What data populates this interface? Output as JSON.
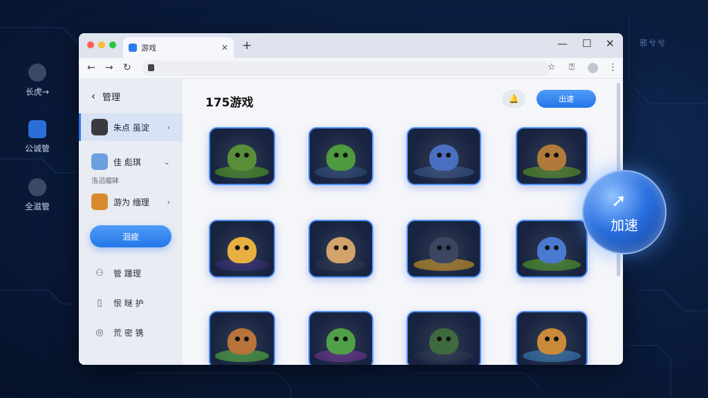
{
  "desktop": {
    "items": [
      {
        "label": "长虎→",
        "icon": "leaf-icon"
      },
      {
        "label": "公诚管",
        "icon": "chart-search-icon"
      },
      {
        "label": "全滋管",
        "icon": "gear-icon"
      }
    ],
    "corner_text": "邪兮兮"
  },
  "browser": {
    "tab_title": "游戏",
    "tab_icon": "app-icon",
    "new_tab": "+",
    "controls": {
      "minimize": "—",
      "maximize": "☐",
      "close": "✕"
    },
    "nav": {
      "back": "←",
      "forward": "→",
      "reload": "↻"
    },
    "toolbar": {
      "star": "☆",
      "ext": "⍰",
      "menu": "⋮"
    }
  },
  "sidebar": {
    "back_label": "管理",
    "items": [
      {
        "label": "朱点 虽淀",
        "color": "#3a3a40",
        "active": true
      },
      {
        "label": "佳 彪琪",
        "color": "#6aa0e0",
        "active": false
      }
    ],
    "sub_label": "洛滔瘤砵",
    "item3": {
      "label": "游为 缅理",
      "color": "#d98a2e"
    },
    "button": "洄疲",
    "links": [
      {
        "icon": "users-icon",
        "glyph": "⚇",
        "label": "管 踵理"
      },
      {
        "icon": "document-icon",
        "glyph": "▯",
        "label": "恨 瞇 护"
      },
      {
        "icon": "eye-icon",
        "glyph": "◎",
        "label": "荒 密 镌"
      }
    ]
  },
  "main": {
    "title": "175游戏",
    "bell": "🔔",
    "go_button": "出速"
  },
  "games": [
    {
      "name": "game-1",
      "body": "#5a8f3a",
      "ground": "#3a6d2a"
    },
    {
      "name": "game-2",
      "body": "#4e9a3e",
      "ground": "#233a63"
    },
    {
      "name": "game-3",
      "body": "#4a6fc0",
      "ground": "#2a3f6a"
    },
    {
      "name": "game-4",
      "body": "#b07a3a",
      "ground": "#3f6a2a"
    },
    {
      "name": "game-5",
      "body": "#e8b040",
      "ground": "#2a2660"
    },
    {
      "name": "game-6",
      "body": "#d2a36a",
      "ground": "#1f2a44"
    },
    {
      "name": "game-7",
      "body": "#3c4660",
      "ground": "#8a6a2a"
    },
    {
      "name": "game-8",
      "body": "#4a7ad0",
      "ground": "#3a6d2a"
    },
    {
      "name": "game-9",
      "body": "#b8743a",
      "ground": "#3a7a3a"
    },
    {
      "name": "game-10",
      "body": "#4fa048",
      "ground": "#4a2a70"
    },
    {
      "name": "game-11",
      "body": "#3f6a40",
      "ground": "#1f2a44"
    },
    {
      "name": "game-12",
      "body": "#c98a3a",
      "ground": "#2a5a8a"
    }
  ],
  "bubble": {
    "label": "加速",
    "icon": "speed-icon"
  }
}
